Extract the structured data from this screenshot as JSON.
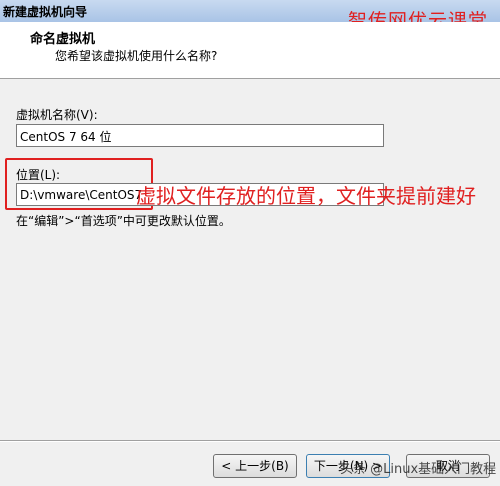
{
  "window": {
    "title": "新建虚拟机向导"
  },
  "watermark_top": "智传网优云课堂",
  "header": {
    "title": "命名虚拟机",
    "subtitle": "您希望该虚拟机使用什么名称?"
  },
  "vm_name": {
    "label": "虚拟机名称(V):",
    "value": "CentOS 7 64 位"
  },
  "location": {
    "label": "位置(L):",
    "value": "D:\\vmware\\CentOS7"
  },
  "annotation": "虚拟文件存放的位置，文件夹提前建好",
  "hint": "在“编辑”>“首选项”中可更改默认位置。",
  "buttons": {
    "back": "< 上一步(B)",
    "next": "下一步(N) >",
    "cancel": "取消"
  },
  "watermark_bottom": "头条 @Linux基础入门教程",
  "colors": {
    "annotation": "#e02020",
    "titlebar": "#b8d0ee"
  }
}
